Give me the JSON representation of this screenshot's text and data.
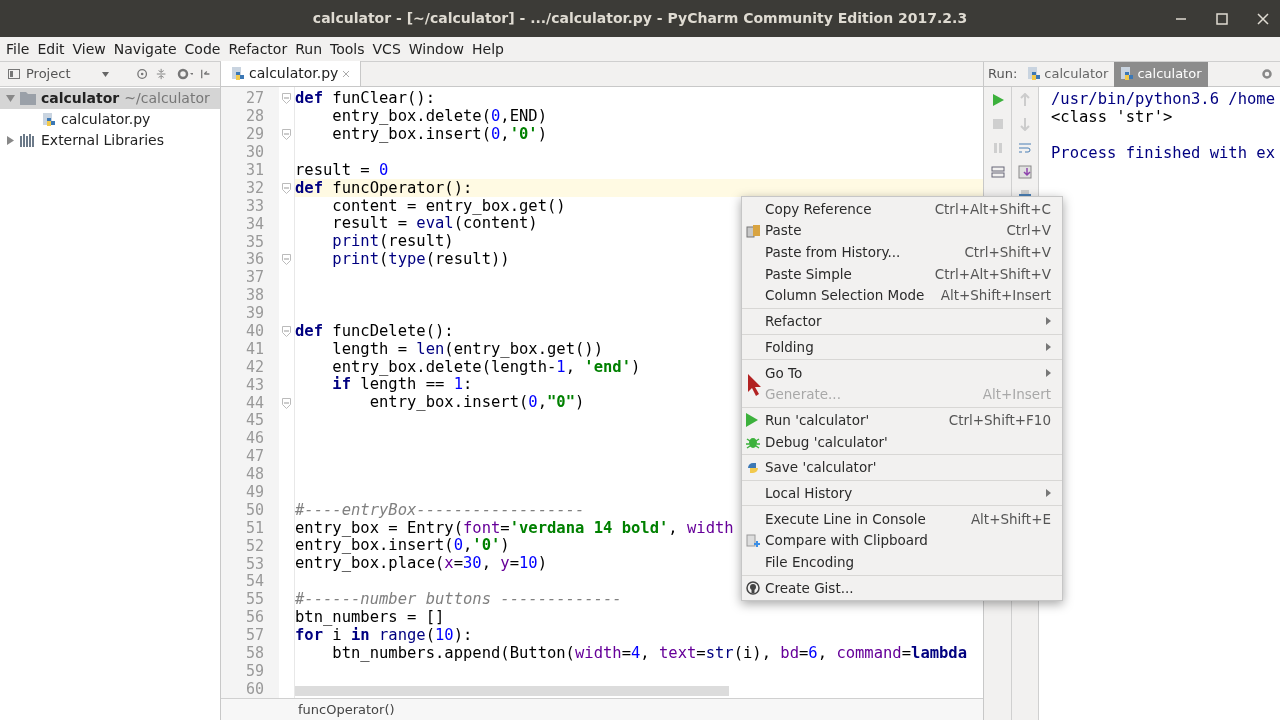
{
  "window": {
    "title": "calculator - [~/calculator] - .../calculator.py - PyCharm Community Edition 2017.2.3"
  },
  "menubar": [
    "File",
    "Edit",
    "View",
    "Navigate",
    "Code",
    "Refactor",
    "Run",
    "Tools",
    "VCS",
    "Window",
    "Help"
  ],
  "project": {
    "title": "Project",
    "tree": [
      {
        "label": "calculator",
        "path": "~/calculator",
        "expanded": true,
        "selected": true,
        "children": [
          {
            "label": "calculator.py",
            "selected": false
          }
        ]
      },
      {
        "label": "External Libraries",
        "expanded": false,
        "selected": false
      }
    ]
  },
  "editor": {
    "tabs": [
      {
        "label": "calculator.py",
        "selected": true
      }
    ],
    "lines": [
      {
        "number": "27",
        "fold": true,
        "current": false,
        "segments": [
          {
            "t": "def",
            "kind": "keyword"
          },
          {
            "t": " funClear():",
            "kind": "plain"
          }
        ]
      },
      {
        "number": "28",
        "fold": false,
        "current": false,
        "segments": [
          {
            "t": "    entry_box.delete(",
            "kind": "plain"
          },
          {
            "t": "0",
            "kind": "number"
          },
          {
            "t": ",END)",
            "kind": "plain"
          }
        ]
      },
      {
        "number": "29",
        "fold": true,
        "current": false,
        "segments": [
          {
            "t": "    entry_box.insert(",
            "kind": "plain"
          },
          {
            "t": "0",
            "kind": "number"
          },
          {
            "t": ",",
            "kind": "plain"
          },
          {
            "t": "'0'",
            "kind": "string"
          },
          {
            "t": ")",
            "kind": "plain"
          }
        ]
      },
      {
        "number": "30",
        "fold": false,
        "current": false
      },
      {
        "number": "31",
        "fold": false,
        "current": false,
        "segments": [
          {
            "t": "result = ",
            "kind": "plain"
          },
          {
            "t": "0",
            "kind": "number"
          }
        ]
      },
      {
        "number": "32",
        "fold": true,
        "current": true,
        "segments": [
          {
            "t": "def",
            "kind": "keyword"
          },
          {
            "t": " funcOperator():",
            "kind": "plain"
          }
        ]
      },
      {
        "number": "33",
        "fold": false,
        "current": false,
        "segments": [
          {
            "t": "    content = entry_box.get()",
            "kind": "plain"
          }
        ]
      },
      {
        "number": "34",
        "fold": false,
        "current": false,
        "segments": [
          {
            "t": "    result = ",
            "kind": "plain"
          },
          {
            "t": "eval",
            "kind": "builtin"
          },
          {
            "t": "(content)",
            "kind": "plain"
          }
        ]
      },
      {
        "number": "35",
        "fold": false,
        "current": false,
        "segments": [
          {
            "t": "    print",
            "kind": "builtin"
          },
          {
            "t": "(result)",
            "kind": "plain"
          }
        ]
      },
      {
        "number": "36",
        "fold": true,
        "current": false,
        "segments": [
          {
            "t": "    print",
            "kind": "builtin"
          },
          {
            "t": "(",
            "kind": "plain"
          },
          {
            "t": "type",
            "kind": "builtin"
          },
          {
            "t": "(result))",
            "kind": "plain"
          }
        ]
      },
      {
        "number": "37",
        "fold": false,
        "current": false
      },
      {
        "number": "38",
        "fold": false,
        "current": false
      },
      {
        "number": "39",
        "fold": false,
        "current": false
      },
      {
        "number": "40",
        "fold": true,
        "current": false,
        "segments": [
          {
            "t": "def",
            "kind": "keyword"
          },
          {
            "t": " funcDelete():",
            "kind": "plain"
          }
        ]
      },
      {
        "number": "41",
        "fold": false,
        "current": false,
        "segments": [
          {
            "t": "    length = ",
            "kind": "plain"
          },
          {
            "t": "len",
            "kind": "builtin"
          },
          {
            "t": "(entry_box.get())",
            "kind": "plain"
          }
        ]
      },
      {
        "number": "42",
        "fold": false,
        "current": false,
        "segments": [
          {
            "t": "    entry_box.delete(length-",
            "kind": "plain"
          },
          {
            "t": "1",
            "kind": "number"
          },
          {
            "t": ", ",
            "kind": "plain"
          },
          {
            "t": "'end'",
            "kind": "string"
          },
          {
            "t": ")",
            "kind": "plain"
          }
        ]
      },
      {
        "number": "43",
        "fold": false,
        "current": false,
        "segments": [
          {
            "t": "    if",
            "kind": "keyword"
          },
          {
            "t": " length == ",
            "kind": "plain"
          },
          {
            "t": "1",
            "kind": "number"
          },
          {
            "t": ":",
            "kind": "plain"
          }
        ]
      },
      {
        "number": "44",
        "fold": true,
        "current": false,
        "segments": [
          {
            "t": "        entry_box.insert(",
            "kind": "plain"
          },
          {
            "t": "0",
            "kind": "number"
          },
          {
            "t": ",",
            "kind": "plain"
          },
          {
            "t": "\"0\"",
            "kind": "string"
          },
          {
            "t": ")",
            "kind": "plain"
          }
        ]
      },
      {
        "number": "45",
        "fold": false,
        "current": false
      },
      {
        "number": "46",
        "fold": false,
        "current": false
      },
      {
        "number": "47",
        "fold": false,
        "current": false
      },
      {
        "number": "48",
        "fold": false,
        "current": false
      },
      {
        "number": "49",
        "fold": false,
        "current": false
      },
      {
        "number": "50",
        "fold": false,
        "current": false,
        "segments": [
          {
            "t": "#----entryBox------------------",
            "kind": "comment"
          }
        ]
      },
      {
        "number": "51",
        "fold": false,
        "current": false,
        "segments": [
          {
            "t": "entry_box = Entry(",
            "kind": "plain"
          },
          {
            "t": "font",
            "kind": "param"
          },
          {
            "t": "=",
            "kind": "plain"
          },
          {
            "t": "'verdana 14 bold'",
            "kind": "string"
          },
          {
            "t": ", ",
            "kind": "plain"
          },
          {
            "t": "width",
            "kind": "param"
          }
        ]
      },
      {
        "number": "52",
        "fold": false,
        "current": false,
        "segments": [
          {
            "t": "entry_box.insert(",
            "kind": "plain"
          },
          {
            "t": "0",
            "kind": "number"
          },
          {
            "t": ",",
            "kind": "plain"
          },
          {
            "t": "'0'",
            "kind": "string"
          },
          {
            "t": ")",
            "kind": "plain"
          }
        ]
      },
      {
        "number": "53",
        "fold": false,
        "current": false,
        "segments": [
          {
            "t": "entry_box.place(",
            "kind": "plain"
          },
          {
            "t": "x",
            "kind": "param"
          },
          {
            "t": "=",
            "kind": "plain"
          },
          {
            "t": "30",
            "kind": "number"
          },
          {
            "t": ", ",
            "kind": "plain"
          },
          {
            "t": "y",
            "kind": "param"
          },
          {
            "t": "=",
            "kind": "plain"
          },
          {
            "t": "10",
            "kind": "number"
          },
          {
            "t": ")",
            "kind": "plain"
          }
        ]
      },
      {
        "number": "54",
        "fold": false,
        "current": false
      },
      {
        "number": "55",
        "fold": false,
        "current": false,
        "segments": [
          {
            "t": "#------number buttons -------------",
            "kind": "comment"
          }
        ]
      },
      {
        "number": "56",
        "fold": false,
        "current": false,
        "segments": [
          {
            "t": "btn_numbers = []",
            "kind": "plain"
          }
        ]
      },
      {
        "number": "57",
        "fold": false,
        "current": false,
        "segments": [
          {
            "t": "for",
            "kind": "keyword"
          },
          {
            "t": " i ",
            "kind": "plain"
          },
          {
            "t": "in",
            "kind": "keyword"
          },
          {
            "t": " range",
            "kind": "builtin"
          },
          {
            "t": "(",
            "kind": "plain"
          },
          {
            "t": "10",
            "kind": "number"
          },
          {
            "t": "):",
            "kind": "plain"
          }
        ]
      },
      {
        "number": "58",
        "fold": false,
        "current": false,
        "segments": [
          {
            "t": "    btn_numbers.append(Button(",
            "kind": "plain"
          },
          {
            "t": "width",
            "kind": "param"
          },
          {
            "t": "=",
            "kind": "plain"
          },
          {
            "t": "4",
            "kind": "number"
          },
          {
            "t": ", ",
            "kind": "plain"
          },
          {
            "t": "text",
            "kind": "param"
          },
          {
            "t": "=",
            "kind": "plain"
          },
          {
            "t": "str",
            "kind": "builtin"
          },
          {
            "t": "(i), ",
            "kind": "plain"
          },
          {
            "t": "bd",
            "kind": "param"
          },
          {
            "t": "=",
            "kind": "plain"
          },
          {
            "t": "6",
            "kind": "number"
          },
          {
            "t": ", ",
            "kind": "plain"
          },
          {
            "t": "command",
            "kind": "param"
          },
          {
            "t": "=",
            "kind": "plain"
          },
          {
            "t": "lambda",
            "kind": "keyword"
          }
        ]
      },
      {
        "number": "59",
        "fold": false,
        "current": false
      },
      {
        "number": "60",
        "fold": false,
        "current": false
      }
    ],
    "breadcrumb": "funcOperator()"
  },
  "run": {
    "label": "Run:",
    "tabs": [
      {
        "label": "calculator",
        "selected": false
      },
      {
        "label": "calculator",
        "selected": true
      }
    ],
    "console": [
      {
        "text": "/usr/bin/python3.6 /home",
        "kind": "system"
      },
      {
        "text": "<class 'str'>",
        "kind": "output"
      },
      {
        "kind": "blank"
      },
      {
        "text": "Process finished with ex",
        "kind": "system"
      }
    ]
  },
  "context_menu": {
    "groups": [
      [
        {
          "label": "Copy Reference",
          "shortcut": "Ctrl+Alt+Shift+C",
          "kind": "item",
          "disabled": false
        },
        {
          "label": "Paste",
          "shortcut": "Ctrl+V",
          "kind": "item",
          "disabled": false
        },
        {
          "label": "Paste from History...",
          "shortcut": "Ctrl+Shift+V",
          "kind": "item",
          "disabled": false
        },
        {
          "label": "Paste Simple",
          "shortcut": "Ctrl+Alt+Shift+V",
          "kind": "item",
          "disabled": false
        },
        {
          "label": "Column Selection Mode",
          "shortcut": "Alt+Shift+Insert",
          "kind": "item",
          "disabled": false
        }
      ],
      [
        {
          "label": "Refactor",
          "kind": "submenu",
          "disabled": false
        }
      ],
      [
        {
          "label": "Folding",
          "kind": "submenu",
          "disabled": false
        }
      ],
      [
        {
          "label": "Go To",
          "kind": "submenu",
          "disabled": false
        },
        {
          "label": "Generate...",
          "shortcut": "Alt+Insert",
          "kind": "item",
          "disabled": true
        }
      ],
      [
        {
          "label": "Run 'calculator'",
          "shortcut": "Ctrl+Shift+F10",
          "kind": "item",
          "disabled": false
        },
        {
          "label": "Debug 'calculator'",
          "kind": "item",
          "disabled": false
        }
      ],
      [
        {
          "label": "Save 'calculator'",
          "kind": "item",
          "disabled": false
        }
      ],
      [
        {
          "label": "Local History",
          "kind": "submenu",
          "disabled": false
        }
      ],
      [
        {
          "label": "Execute Line in Console",
          "shortcut": "Alt+Shift+E",
          "kind": "item",
          "disabled": false
        },
        {
          "label": "Compare with Clipboard",
          "kind": "item",
          "disabled": false
        },
        {
          "label": "File Encoding",
          "kind": "item",
          "disabled": false
        }
      ],
      [
        {
          "label": "Create Gist...",
          "kind": "item",
          "disabled": false
        }
      ]
    ]
  }
}
